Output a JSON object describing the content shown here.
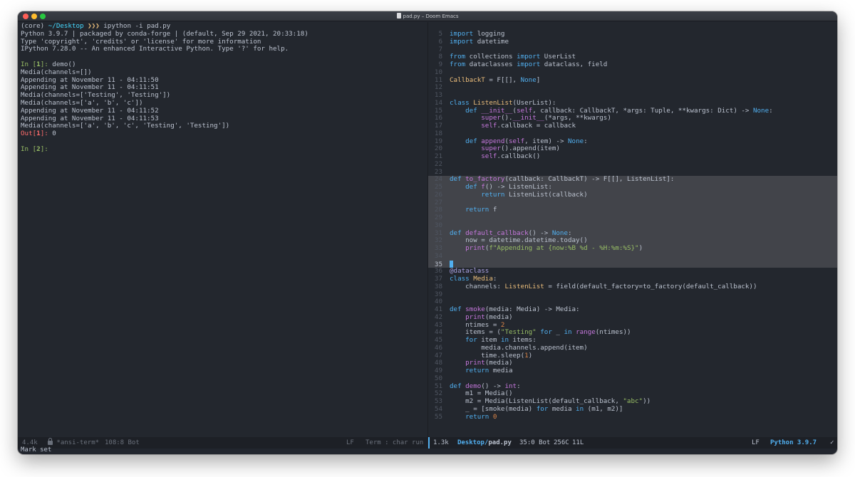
{
  "window": {
    "title": "pad.py – Doom Emacs"
  },
  "terminal": {
    "prompt_env": "(core)",
    "prompt_dir": "~/Desktop",
    "prompt_arrows": "❯❯❯",
    "prompt_cmd": "ipython -i pad.py",
    "banner": [
      "Python 3.9.7 | packaged by conda-forge | (default, Sep 29 2021, 20:33:18)",
      "Type 'copyright', 'credits' or 'license' for more information",
      "IPython 7.28.0 -- An enhanced Interactive Python. Type '?' for help."
    ],
    "in1_prefix": "In [",
    "in1_num": "1",
    "in1_suffix": "]: ",
    "in1_cmd": "demo()",
    "output": [
      "Media(channels=[])",
      "Appending at November 11 - 04:11:50",
      "Appending at November 11 - 04:11:51",
      "Media(channels=['Testing', 'Testing'])",
      "Media(channels=['a', 'b', 'c'])",
      "Appending at November 11 - 04:11:52",
      "Appending at November 11 - 04:11:53",
      "Media(channels=['a', 'b', 'c', 'Testing', 'Testing'])"
    ],
    "out1_prefix": "Out[",
    "out1_num": "1",
    "out1_suffix": "]: ",
    "out1_value": "0",
    "in2_prefix": "In [",
    "in2_num": "2",
    "in2_suffix": "]:"
  },
  "editor": {
    "line_numbers": [
      "5",
      "6",
      "7",
      "8",
      "9",
      "10",
      "11",
      "12",
      "13",
      "14",
      "15",
      "16",
      "17",
      "18",
      "19",
      "20",
      "21",
      "22",
      "23",
      "24",
      "25",
      "26",
      "27",
      "28",
      "29",
      "30",
      "31",
      "32",
      "33",
      "34",
      "35",
      "36",
      "37",
      "38",
      "39",
      "40",
      "41",
      "42",
      "43",
      "44",
      "45",
      "46",
      "47",
      "48",
      "49",
      "50",
      "51",
      "52",
      "53",
      "54",
      "55"
    ],
    "code": {
      "l5a": "import",
      "l5b": " logging",
      "l6a": "import",
      "l6b": " datetime",
      "l8a": "from",
      "l8b": " collections ",
      "l8c": "import",
      "l8d": " UserList",
      "l9a": "from",
      "l9b": " dataclasses ",
      "l9c": "import",
      "l9d": " dataclass, field",
      "l11a": "CallbackT",
      "l11b": " = F[[], ",
      "l11c": "None",
      "l11d": "]",
      "l14a": "class",
      "l14b": " ListenList",
      "l14c": "(UserList):",
      "l15a": "    def",
      "l15b": " __init__",
      "l15c": "(",
      "l15d": "self",
      "l15e": ", callback: CallbackT, *args: Tuple, **kwargs: Dict) -> ",
      "l15f": "None",
      "l15g": ":",
      "l16a": "        ",
      "l16b": "super",
      "l16c": "().",
      "l16d": "__init__",
      "l16e": "(*args, **kwargs)",
      "l17a": "        ",
      "l17b": "self",
      "l17c": ".callback = callback",
      "l19a": "    def",
      "l19b": " append",
      "l19c": "(",
      "l19d": "self",
      "l19e": ", item) -> ",
      "l19f": "None",
      "l19g": ":",
      "l20a": "        ",
      "l20b": "super",
      "l20c": "().append(item)",
      "l21a": "        ",
      "l21b": "self",
      "l21c": ".callback()",
      "l24a": "def",
      "l24b": " to_factory",
      "l24c": "(callback: CallbackT) -> F[[], ListenList]:",
      "l25a": "    def",
      "l25b": " f",
      "l25c": "() -> ListenList:",
      "l26a": "        return",
      "l26b": " ListenList(callback)",
      "l28a": "    return",
      "l28b": " f",
      "l31a": "def",
      "l31b": " default_callback",
      "l31c": "() -> ",
      "l31d": "None",
      "l31e": ":",
      "l32a": "    now = datetime.datetime.today()",
      "l33a": "    ",
      "l33b": "print",
      "l33c": "(",
      "l33d": "f\"Appending at {now:%B %d - %H:%m:%S}\"",
      "l33e": ")",
      "l36a": "@dataclass",
      "l37a": "class",
      "l37b": " Media",
      "l37c": ":",
      "l38a": "    channels: ",
      "l38b": "ListenList",
      "l38c": " = field(default_factory=to_factory(default_callback))",
      "l41a": "def",
      "l41b": " smoke",
      "l41c": "(media: Media) -> Media:",
      "l42a": "    ",
      "l42b": "print",
      "l42c": "(media)",
      "l43a": "    ntimes = ",
      "l43b": "2",
      "l44a": "    items = (",
      "l44b": "\"Testing\"",
      "l44c": " for",
      "l44d": " _ ",
      "l44e": "in",
      "l44f": " ",
      "l44g": "range",
      "l44h": "(ntimes))",
      "l45a": "    for",
      "l45b": " item ",
      "l45c": "in",
      "l45d": " items:",
      "l46a": "        media.channels.append(item)",
      "l47a": "        time.sleep(",
      "l47b": "1",
      "l47c": ")",
      "l48a": "    ",
      "l48b": "print",
      "l48c": "(media)",
      "l49a": "    return",
      "l49b": " media",
      "l51a": "def",
      "l51b": " demo",
      "l51c": "() -> ",
      "l51d": "int",
      "l51e": ":",
      "l52a": "    m1 = Media()",
      "l53a": "    m2 = Media(ListenList(default_callback, ",
      "l53b": "\"abc\"",
      "l53c": "))",
      "l54a": "    _ = [smoke(media) ",
      "l54b": "for",
      "l54c": " media ",
      "l54d": "in",
      "l54e": " (m1, m2)]",
      "l55a": "    return",
      "l55b": " ",
      "l55c": "0"
    }
  },
  "modeline_left": {
    "size": "4.4k",
    "buffer": "*ansi-term*",
    "position": "108:8 Bot",
    "eol": "LF",
    "mode": "Term : char run"
  },
  "modeline_right": {
    "size": "1.3k",
    "path_dir": "Desktop/",
    "path_file": "pad.py",
    "position": "35:0 Bot",
    "chars": "256C",
    "lines": "11L",
    "eol": "LF",
    "language": "Python 3.9.7",
    "check": "✓"
  },
  "minibuffer": {
    "message": "Mark set"
  },
  "colors": {
    "background": "#23272e",
    "selection": "#42444a",
    "keyword": "#51afef",
    "function": "#c678dd",
    "string": "#98be65",
    "number": "#da8548",
    "type": "#ecbe7b"
  }
}
